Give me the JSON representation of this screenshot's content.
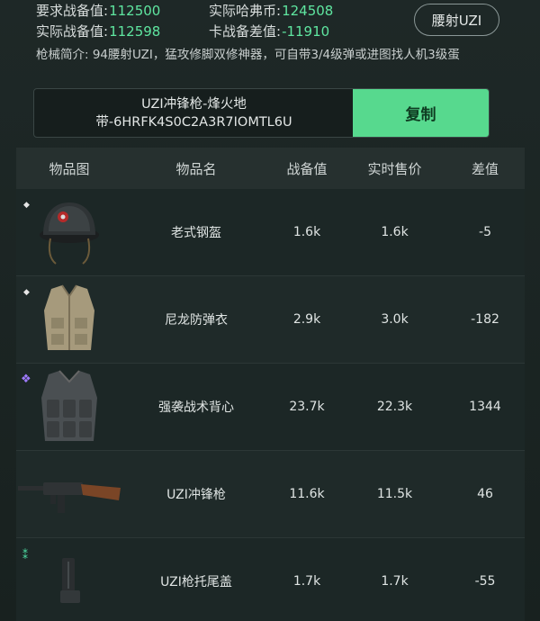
{
  "stats": {
    "required_label": "要求战备值:",
    "required_value": "112500",
    "actual_hafcoin_label": "实际哈弗币:",
    "actual_hafcoin_value": "124508",
    "actual_label": "实际战备值:",
    "actual_value": "112598",
    "diff_label": "卡战备差值:",
    "diff_value": "-11910"
  },
  "weapon_tag": "腰射UZI",
  "intro": "枪械简介: 94腰射UZI，猛攻修脚双修神器，可自带3/4级弹或进图找人机3级蛋",
  "code": {
    "line1": "UZI冲锋枪-烽火地",
    "line2": "带-6HRFK4S0C2A3R7IOMTL6U",
    "copy_label": "复制"
  },
  "table": {
    "headers": [
      "物品图",
      "物品名",
      "战备值",
      "实时售价",
      "差值"
    ],
    "rows": [
      {
        "rarity_icon": "white-diamond-icon",
        "image_icon": "helmet-icon",
        "name": "老式钢盔",
        "value": "1.6k",
        "price": "1.6k",
        "diff": "-5"
      },
      {
        "rarity_icon": "white-diamond-icon",
        "image_icon": "vest-icon",
        "name": "尼龙防弹衣",
        "value": "2.9k",
        "price": "3.0k",
        "diff": "-182"
      },
      {
        "rarity_icon": "purple-diamond-icon",
        "image_icon": "tactical-vest-icon",
        "name": "强袭战术背心",
        "value": "23.7k",
        "price": "22.3k",
        "diff": "1344"
      },
      {
        "rarity_icon": "",
        "image_icon": "smg-icon",
        "name": "UZI冲锋枪",
        "value": "11.6k",
        "price": "11.5k",
        "diff": "46"
      },
      {
        "rarity_icon": "green-diamond-icon",
        "image_icon": "buttplate-icon",
        "name": "UZI枪托尾盖",
        "value": "1.7k",
        "price": "1.7k",
        "diff": "-55"
      }
    ]
  },
  "colors": {
    "accent_green": "#57d98e",
    "value_green": "#5fe6a0",
    "background": "#1b2423"
  }
}
